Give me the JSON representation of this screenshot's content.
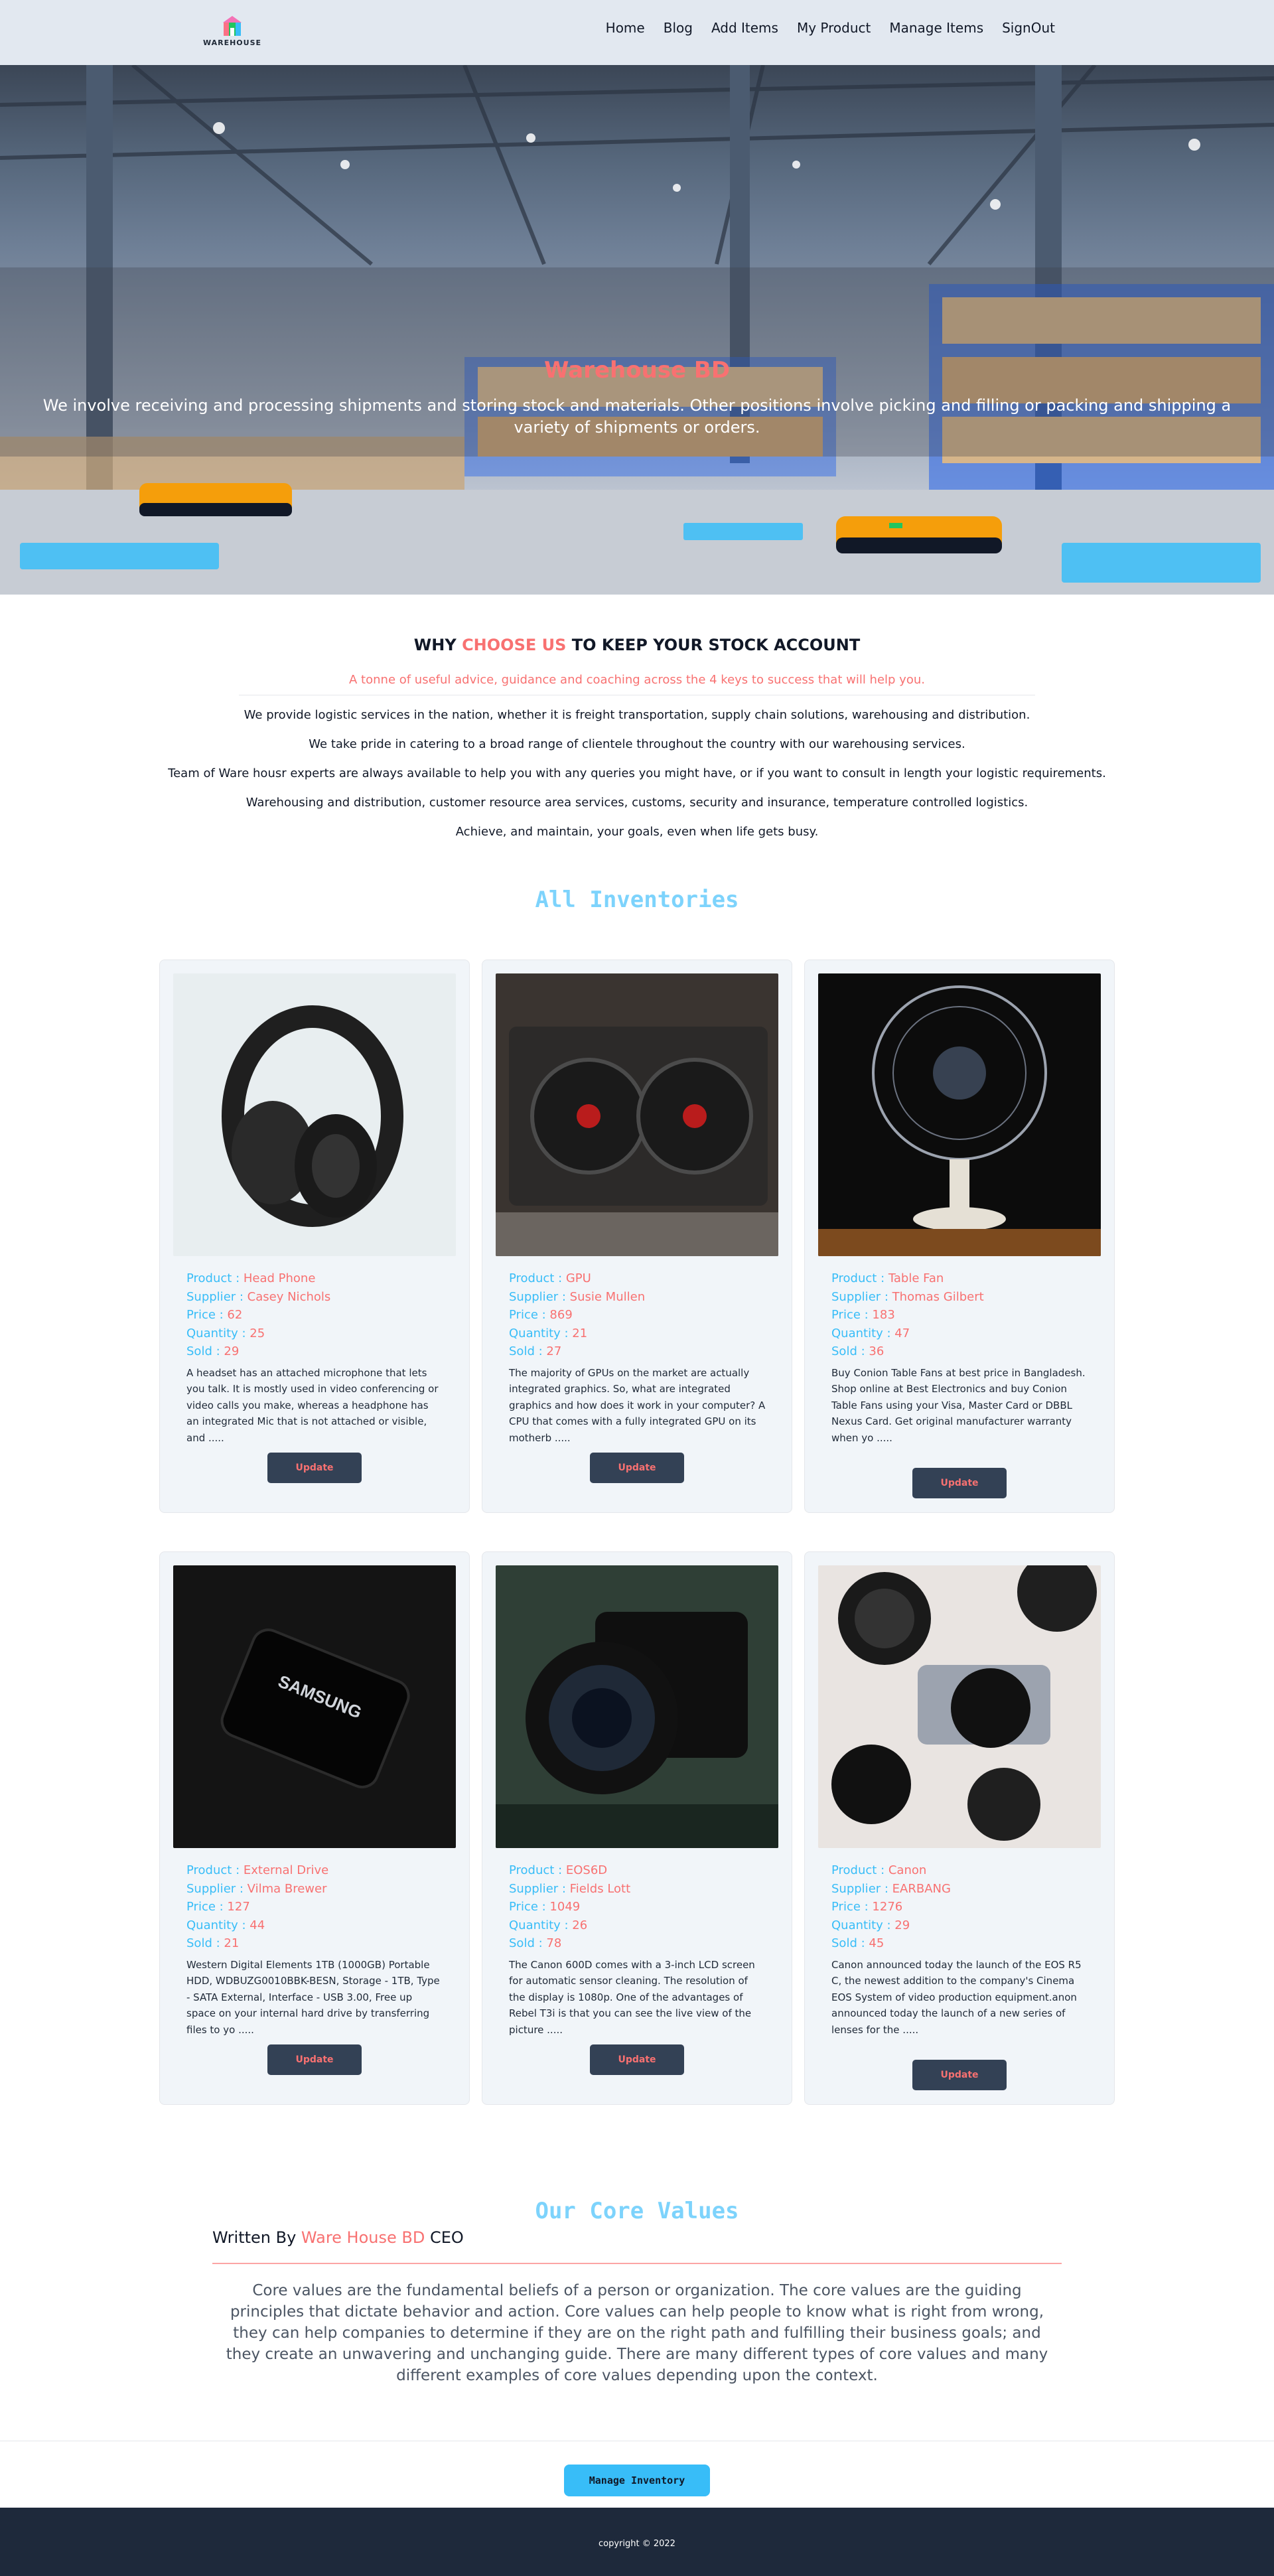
{
  "nav": {
    "logo_text": "WAREHOUSE",
    "links": [
      "Home",
      "Blog",
      "Add Items",
      "My Product",
      "Manage Items",
      "SignOut"
    ]
  },
  "hero": {
    "title": "Warehouse BD",
    "subtitle": "We involve receiving and processing shipments and storing stock and materials. Other positions involve picking and filling or packing and shipping a variety of shipments or orders."
  },
  "why": {
    "title_prefix": "WHY",
    "title_accent": "CHOOSE US",
    "title_suffix": "TO KEEP YOUR STOCK ACCOUNT",
    "tagline": "A tonne of useful advice, guidance and coaching across the 4 keys to success that will help you.",
    "lines": [
      "We provide logistic services in the nation, whether it is freight transportation, supply chain solutions, warehousing and distribution.",
      "We take pride in catering to a broad range of clientele throughout the country with our warehousing services.",
      "Team of Ware housr experts are always available to help you with any queries you might have, or if you want to consult in length your logistic requirements.",
      "Warehousing and distribution, customer resource area services, customs, security and insurance, temperature controlled logistics.",
      "Achieve, and maintain, your goals, even when life gets busy."
    ]
  },
  "inventory": {
    "title": "All Inventories",
    "labels": {
      "product": "Product : ",
      "supplier": "Supplier : ",
      "price": "Price : ",
      "quantity": "Quantity : ",
      "sold": "Sold : "
    },
    "button_label": "Update",
    "items": [
      {
        "product": "Head Phone",
        "supplier": "Casey Nichols",
        "price": "62",
        "quantity": "25",
        "sold": "29",
        "image": "headphones-image",
        "description": "A headset has an attached microphone that lets you talk. It is mostly used in video conferencing or video calls you make, whereas a headphone has an integrated Mic that is not attached or visible, and ....."
      },
      {
        "product": "GPU",
        "supplier": "Susie Mullen",
        "price": "869",
        "quantity": "21",
        "sold": "27",
        "image": "gpu-image",
        "description": "The majority of GPUs on the market are actually integrated graphics. So, what are integrated graphics and how does it work in your computer? A CPU that comes with a fully integrated GPU on its motherb ....."
      },
      {
        "product": "Table Fan",
        "supplier": "Thomas Gilbert",
        "price": "183",
        "quantity": "47",
        "sold": "36",
        "image": "table-fan-image",
        "description": "Buy Conion Table Fans at best price in Bangladesh. Shop online at Best Electronics and buy Conion Table Fans using your Visa, Master Card or DBBL Nexus Card. Get original manufacturer warranty when yo ....."
      },
      {
        "product": "External Drive",
        "supplier": "Vilma Brewer",
        "price": "127",
        "quantity": "44",
        "sold": "21",
        "image": "external-drive-image",
        "description": "Western Digital Elements 1TB (1000GB) Portable HDD, WDBUZG0010BBK-BESN, Storage - 1TB, Type - SATA External, Interface - USB 3.00, Free up space on your internal hard drive by transferring files to yo ....."
      },
      {
        "product": "EOS6D",
        "supplier": "Fields Lott",
        "price": "1049",
        "quantity": "26",
        "sold": "78",
        "image": "dslr-camera-image",
        "description": "The Canon 600D comes with a 3-inch LCD screen for automatic sensor cleaning. The resolution of the display is 1080p. One of the advantages of Rebel T3i is that you can see the live view of the picture ....."
      },
      {
        "product": "Canon",
        "supplier": "EARBANG",
        "price": "1276",
        "quantity": "29",
        "sold": "45",
        "image": "cameras-lenses-image",
        "description": "Canon announced today the launch of the EOS R5 C, the newest addition to the company's Cinema EOS System of video production equipment.anon announced today the launch of a new series of lenses for the ....."
      }
    ]
  },
  "core": {
    "title": "Our Core Values",
    "written_by": "Written By",
    "company": "Ware House BD",
    "role": "CEO",
    "text": "Core values are the fundamental beliefs of a person or organization. The core values are the guiding principles that dictate behavior and action. Core values can help people to know what is right from wrong, they can help companies to determine if they are on the right path and fulfilling their business goals; and they create an unwavering and unchanging guide. There are many different types of core values and many different examples of core values depending upon the context."
  },
  "manage_button": "Manage Inventory",
  "footer": {
    "copyright": "copyright © 2022"
  },
  "colors": {
    "accent_red": "#f87171",
    "accent_blue": "#38bdf8",
    "heading_blue": "#7dd3fc",
    "dark": "#1e293b",
    "nav_bg": "#e2e8f0"
  }
}
